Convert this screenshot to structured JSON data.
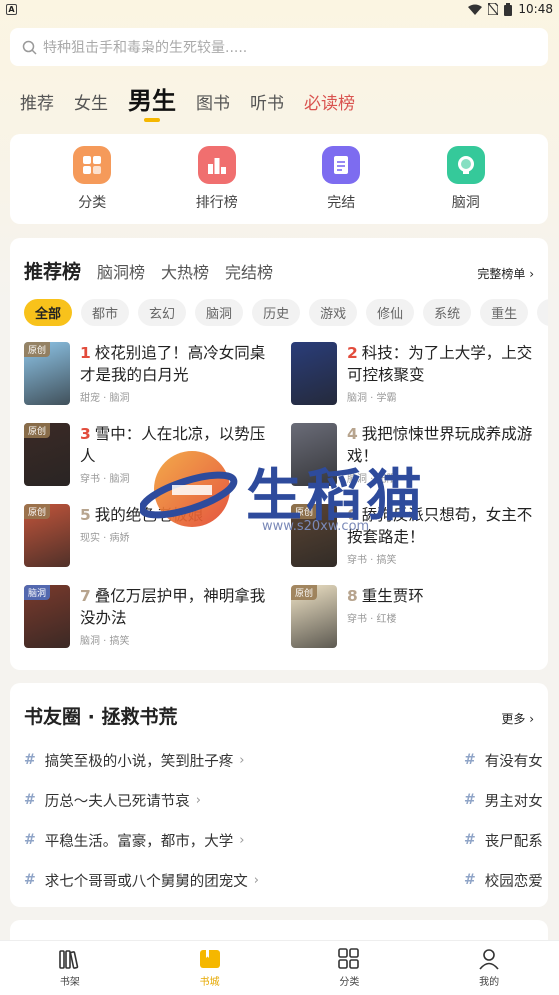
{
  "status": {
    "notif": "A",
    "time": "10:48"
  },
  "search": {
    "placeholder": "特种狙击手和毒枭的生死较量....."
  },
  "tabs": [
    {
      "label": "推荐"
    },
    {
      "label": "女生"
    },
    {
      "label": "男生"
    },
    {
      "label": "图书"
    },
    {
      "label": "听书"
    },
    {
      "label": "必读榜"
    }
  ],
  "quick": [
    {
      "label": "分类",
      "icon": "category-icon",
      "color": "#f59a5a"
    },
    {
      "label": "排行榜",
      "icon": "ranking-icon",
      "color": "#f06f6f"
    },
    {
      "label": "完结",
      "icon": "finished-icon",
      "color": "#7d6cf0"
    },
    {
      "label": "脑洞",
      "icon": "brain-icon",
      "color": "#35c99a"
    }
  ],
  "rank": {
    "title": "推荐榜",
    "tabs": [
      "脑洞榜",
      "大热榜",
      "完结榜"
    ],
    "more": "完整榜单 ›",
    "chips": [
      "全部",
      "都市",
      "玄幻",
      "脑洞",
      "历史",
      "游戏",
      "修仙",
      "系统",
      "重生",
      "悬"
    ],
    "books": [
      {
        "rank": "1",
        "title": "校花别追了！高冷女同桌才是我的白月光",
        "meta": "甜宠 · 脑洞",
        "tag": "原创",
        "tag_color": "tan",
        "cover_color": "#8ec5e8"
      },
      {
        "rank": "2",
        "title": "科技：为了上大学，上交可控核聚变",
        "meta": "脑洞 · 学霸",
        "tag": "",
        "tag_color": "",
        "cover_color": "#2a3d7a"
      },
      {
        "rank": "3",
        "title": "雪中：人在北凉，以势压人",
        "meta": "穿书 · 脑洞",
        "tag": "原创",
        "tag_color": "tan",
        "cover_color": "#3b2a26"
      },
      {
        "rank": "4",
        "title": "我把惊悚世界玩成养成游戏！",
        "meta": "脑洞 · 无限",
        "tag": "",
        "tag_color": "",
        "cover_color": "#6a6c78"
      },
      {
        "rank": "5",
        "title": "我的绝色老板娘",
        "meta": "现实 · 病娇",
        "tag": "原创",
        "tag_color": "tan",
        "cover_color": "#c2553b"
      },
      {
        "rank": "6",
        "title": "舔狗反派只想苟，女主不按套路走！",
        "meta": "穿书 · 搞笑",
        "tag": "原创",
        "tag_color": "tan",
        "cover_color": "#5a4433"
      },
      {
        "rank": "7",
        "title": "叠亿万层护甲，神明拿我没办法",
        "meta": "脑洞 · 搞笑",
        "tag": "脑洞",
        "tag_color": "blue",
        "cover_color": "#7a3a2c"
      },
      {
        "rank": "8",
        "title": "重生贾环",
        "meta": "穿书 · 红楼",
        "tag": "原创",
        "tag_color": "tan",
        "cover_color": "#efe3c6"
      }
    ]
  },
  "circle": {
    "title": "书友圈 · 拯救书荒",
    "more": "更多 ›",
    "rows": [
      {
        "left": "搞笑至极的小说，笑到肚子疼",
        "right": "有没有女"
      },
      {
        "left": "历总～夫人已死请节哀",
        "right": "男主对女"
      },
      {
        "left": "平稳生活。富豪，都市，大学",
        "right": "丧尸配系"
      },
      {
        "left": "求七个哥哥或八个舅舅的团宠文",
        "right": "校园恋爱"
      }
    ]
  },
  "nav": [
    {
      "label": "书架",
      "icon": "bookshelf-icon"
    },
    {
      "label": "书城",
      "icon": "bookstore-icon"
    },
    {
      "label": "分类",
      "icon": "grid-icon"
    },
    {
      "label": "我的",
      "icon": "profile-icon"
    }
  ],
  "watermark": {
    "text": "生稻猫",
    "url": "www.s20xw.com"
  }
}
